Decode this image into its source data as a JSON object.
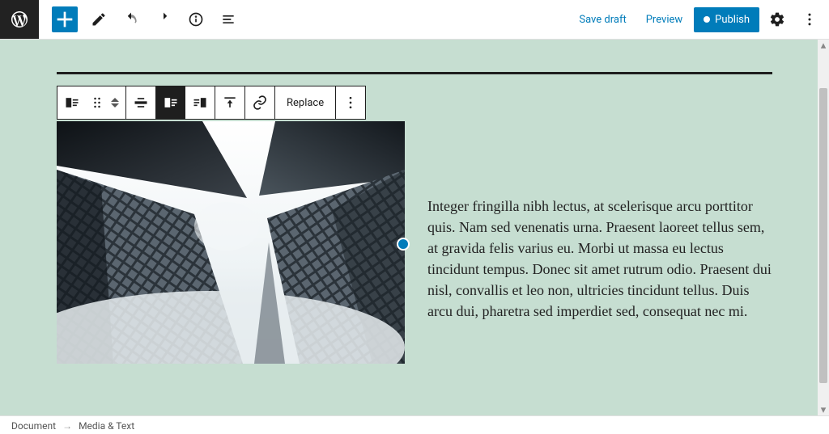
{
  "topbar": {
    "save_draft": "Save draft",
    "preview": "Preview",
    "publish": "Publish"
  },
  "block_toolbar": {
    "replace": "Replace"
  },
  "content": {
    "paragraph": "Integer fringilla nibh lectus, at scelerisque arcu porttitor quis. Nam sed venenatis urna. Praesent laoreet tellus sem, at gravida felis varius eu. Morbi ut massa eu lectus tincidunt tempus. Donec sit amet rutrum odio. Praesent dui nisl, convallis et leo non, ultricies tincidunt tellus. Duis arcu dui, pharetra sed imperdiet sed, consequat nec mi."
  },
  "breadcrumb": {
    "root": "Document",
    "current": "Media & Text"
  }
}
